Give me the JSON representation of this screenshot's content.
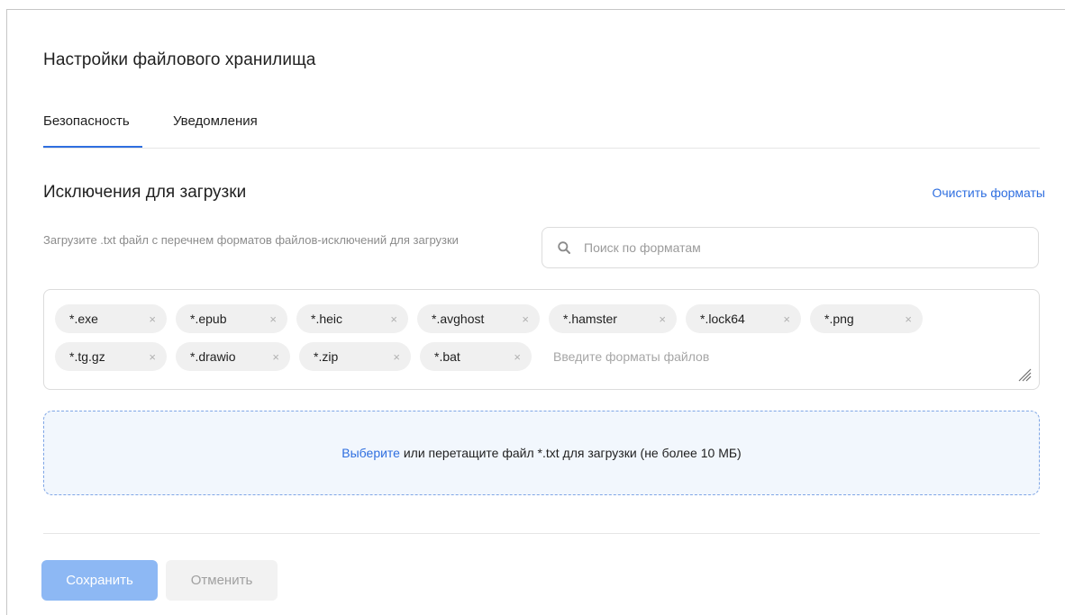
{
  "page": {
    "title": "Настройки файлового хранилища"
  },
  "tabs": [
    {
      "label": "Безопасность",
      "active": true
    },
    {
      "label": "Уведомления",
      "active": false
    }
  ],
  "section": {
    "title": "Исключения для загрузки",
    "clear_link": "Очистить форматы",
    "hint": "Загрузите .txt файл с  перечнем форматов файлов-исключений для загрузки"
  },
  "search": {
    "placeholder": "Поиск по форматам",
    "icon": "search-icon"
  },
  "formats": {
    "row1": [
      "*.exe",
      "*.epub",
      "*.heic",
      "*.avghost",
      "*.hamster",
      "*.lock64",
      "*.png"
    ],
    "row2": [
      "*.tg.gz",
      "*.drawio",
      "*.zip",
      "*.bat"
    ],
    "remove_glyph": "×",
    "input_placeholder": "Введите форматы файлов"
  },
  "dropzone": {
    "link": "Выберите",
    "text": " или перетащите файл *.txt для загрузки (не более 10 МБ)"
  },
  "actions": {
    "save_label": "Сохранить",
    "cancel_label": "Отменить"
  },
  "colors": {
    "accent": "#2f6fe0",
    "save_disabled_bg": "#8db8f4",
    "dropzone_bg": "#f2f7fd"
  }
}
